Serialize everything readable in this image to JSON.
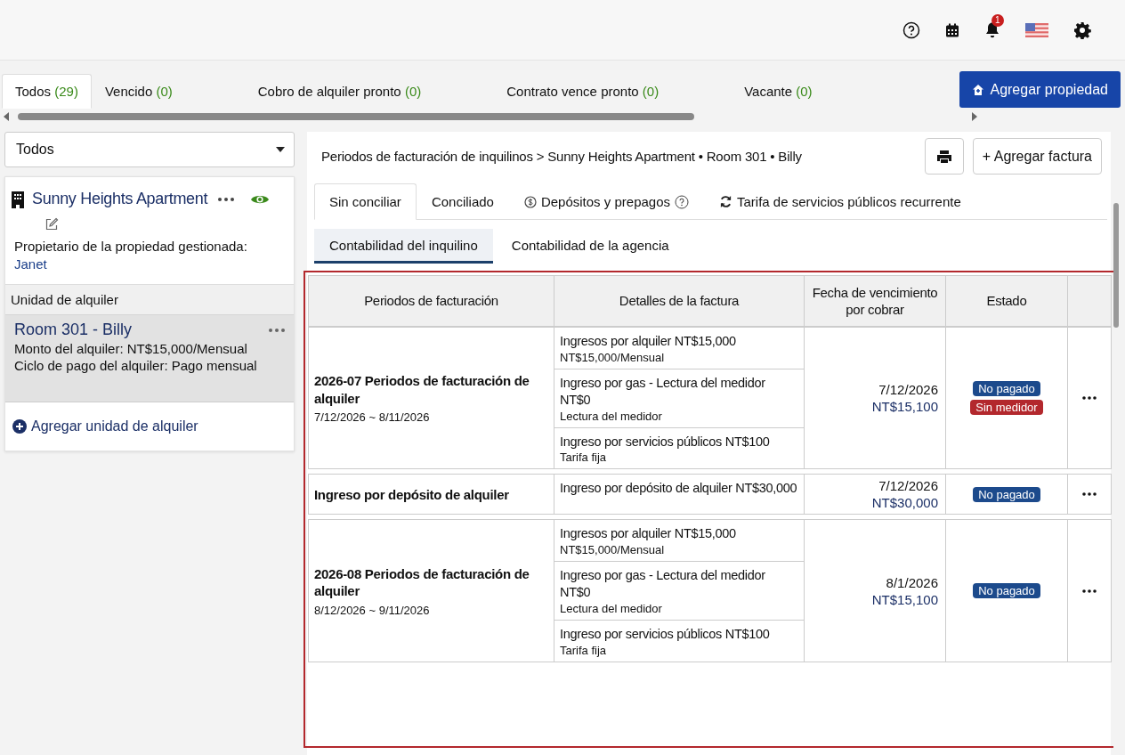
{
  "top_bar": {
    "notification_count": "1"
  },
  "filter_tabs": [
    {
      "label": "Todos",
      "count": "(29)",
      "selected": true
    },
    {
      "label": "Vencido",
      "count": "(0)",
      "selected": false
    },
    {
      "label": "Cobro de alquiler pronto",
      "count": "(0)",
      "selected": false
    },
    {
      "label": "Contrato vence pronto",
      "count": "(0)",
      "selected": false
    },
    {
      "label": "Vacante",
      "count": "(0)",
      "selected": false
    }
  ],
  "add_property_button": "Agregar propiedad",
  "sidebar": {
    "filter": {
      "value": "Todos"
    },
    "property": {
      "name": "Sunny Heights Apartment",
      "owner_label": "Propietario de la propiedad gestionada:",
      "owner": "Janet"
    },
    "units_heading": "Unidad de alquiler",
    "units": [
      {
        "name": "Room 301 - Billy",
        "rent": "Monto del alquiler: NT$15,000/Mensual",
        "cycle": "Ciclo de pago del alquiler: Pago mensual",
        "selected": true
      }
    ],
    "add_unit": "Agregar unidad de alquiler"
  },
  "breadcrumb": "Periodos de facturación de inquilinos > Sunny Heights Apartment • Room 301 • Billy",
  "add_invoice_button": "+ Agregar factura",
  "tabs": [
    {
      "label": "Sin conciliar",
      "kind": "plain",
      "selected": true
    },
    {
      "label": "Conciliado",
      "kind": "plain",
      "selected": false
    },
    {
      "label": "Depósitos y prepagos",
      "kind": "deposit",
      "selected": false
    },
    {
      "label": "Tarifa de servicios públicos recurrente",
      "kind": "recurring",
      "selected": false
    }
  ],
  "subtabs": [
    {
      "label": "Contabilidad del inquilino",
      "selected": true
    },
    {
      "label": "Contabilidad de la agencia",
      "selected": false
    }
  ],
  "table": {
    "columns": [
      "Periodos de facturación",
      "Detalles de la factura",
      "Fecha de vencimiento por cobrar",
      "Estado"
    ],
    "groups": [
      {
        "title": "2026-07 Periodos de facturación de alquiler",
        "dates": "7/12/2026 ~ 8/11/2026",
        "due_date": "7/12/2026",
        "amount": "NT$15,100",
        "lines": [
          {
            "title": "Ingresos por alquiler NT$15,000",
            "note": "NT$15,000/Mensual"
          },
          {
            "title": "Ingreso por gas - Lectura del medidor NT$0",
            "note": "Lectura del medidor"
          },
          {
            "title": "Ingreso por servicios públicos NT$100",
            "note": "Tarifa fija"
          }
        ],
        "badges": [
          {
            "label": "No pagado",
            "color": "#1c4a8c"
          },
          {
            "label": "Sin medidor",
            "color": "#b3282d"
          }
        ]
      },
      {
        "title": "Ingreso por depósito de alquiler",
        "due_date": "7/12/2026",
        "amount": "NT$30,000",
        "lines": [
          {
            "title": "Ingreso por depósito de alquiler NT$30,000"
          }
        ],
        "badges": [
          {
            "label": "No pagado",
            "color": "#1c4a8c"
          }
        ]
      },
      {
        "title": "2026-08 Periodos de facturación de alquiler",
        "dates": "8/12/2026 ~ 9/11/2026",
        "due_date": "8/1/2026",
        "amount": "NT$15,100",
        "lines": [
          {
            "title": "Ingresos por alquiler NT$15,000",
            "note": "NT$15,000/Mensual"
          },
          {
            "title": "Ingreso por gas - Lectura del medidor NT$0",
            "note": "Lectura del medidor"
          },
          {
            "title": "Ingreso por servicios públicos NT$100",
            "note": "Tarifa fija"
          }
        ],
        "badges": [
          {
            "label": "No pagado",
            "color": "#1c4a8c"
          }
        ]
      }
    ]
  }
}
